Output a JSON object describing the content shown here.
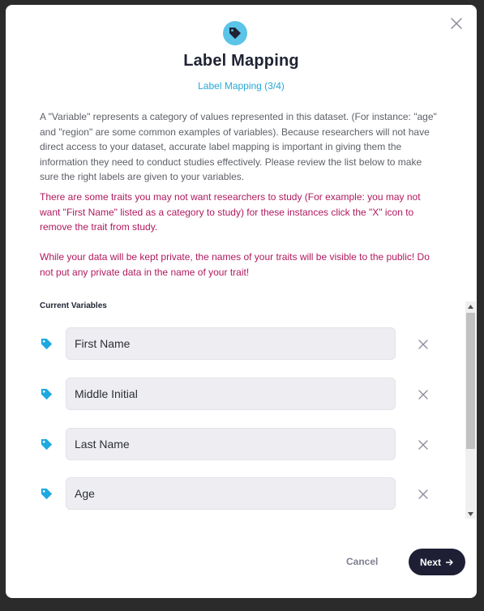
{
  "modal": {
    "title": "Label Mapping",
    "subtitle": "Label Mapping (3/4)",
    "description": "A \"Variable\" represents a category of values represented in this dataset. (For instance: \"age\" and \"region\" are some common examples of variables). Because researchers will not have direct access to your dataset, accurate label mapping is important in giving them the information they need to conduct studies effectively. Please review the list below to make sure the right labels are given to your variables.",
    "warning_remove": "There are some traits you may not want researchers to study (For example: you may not want \"First Name\" listed as a category to study) for these instances click the \"X\" icon to remove the trait from study.",
    "warning_private": "While your data will be kept private, the names of your traits will be visible to the public! Do not put any private data in the name of your trait!",
    "section_label": "Current Variables",
    "variables": [
      {
        "value": "First Name"
      },
      {
        "value": "Middle Initial"
      },
      {
        "value": "Last Name"
      },
      {
        "value": "Age"
      }
    ],
    "cancel_label": "Cancel",
    "next_label": "Next",
    "icons": {
      "header": "tag-icon",
      "close": "close-icon",
      "variable": "tag-icon",
      "remove": "close-icon",
      "next": "arrow-right-icon"
    }
  },
  "colors": {
    "accent": "#26a9d6",
    "warning": "#b0195e",
    "primary_button": "#1e1f35"
  }
}
